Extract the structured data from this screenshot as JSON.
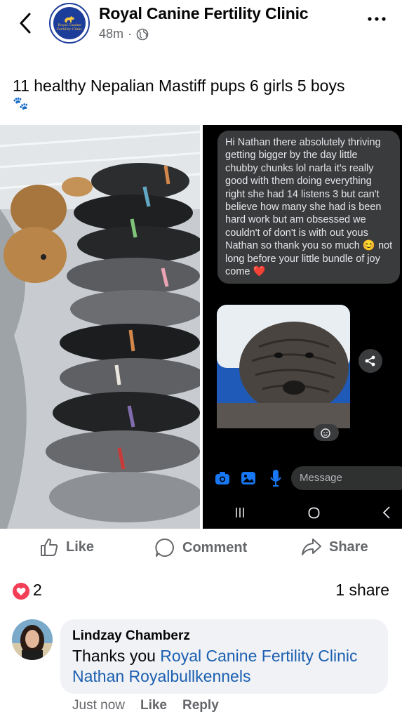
{
  "header": {
    "page_name": "Royal Canine Fertility Clinic",
    "time_ago": "48m",
    "separator": "·",
    "avatar_text": [
      "Royal Canine",
      "Fertility Clinic"
    ],
    "back_icon": "chevron-left-icon",
    "more_icon": "more-dots-icon",
    "privacy_icon": "globe-icon"
  },
  "post": {
    "caption": "11 healthy Nepalian Mastiff pups 6 girls 5 boys",
    "emoji": "🐾"
  },
  "screenshot_chat": {
    "message": "Hi Nathan there absolutely thriving getting bigger by the day little chubby chunks lol narla it's really good with them doing everything right she had 14 listens 3 but can't believe how many she had is been hard work but am obsessed we couldn't of don't is with out yous Nathan so thank you so much 😊 not long before your little bundle of joy come ❤️",
    "composer_placeholder": "Message"
  },
  "actions": {
    "like": "Like",
    "comment": "Comment",
    "share": "Share"
  },
  "stats": {
    "reactions": "2",
    "shares": "1 share"
  },
  "comment": {
    "author": "Lindzay Chamberz",
    "text_prefix": "Thanks you ",
    "mention_1": "Royal Canine Fertility Clinic",
    "mention_2": "Nathan Royalbullkennels",
    "time": "Just now",
    "like": "Like",
    "reply": "Reply"
  },
  "colors": {
    "brand_blue": "#1d3d9a",
    "link": "#1b5fb0",
    "heart": "#f33e58",
    "muted": "#65676b"
  }
}
